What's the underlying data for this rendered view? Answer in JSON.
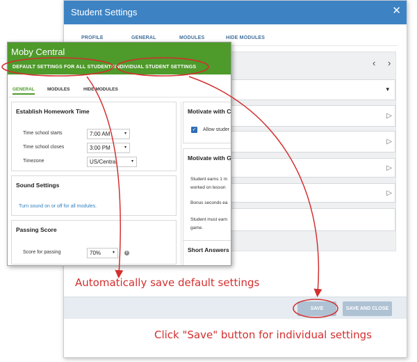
{
  "modal": {
    "title": "Student Settings",
    "close_glyph": "✕",
    "tabs": [
      "PROFILE",
      "GENERAL",
      "MODULES",
      "HIDE MODULES"
    ],
    "prev_glyph": "‹",
    "next_glyph": "›",
    "dropdown_caret": "▾",
    "field_glyph": "▷",
    "save_label": "SAVE",
    "save_close_label": "SAVE AND CLOSE"
  },
  "front": {
    "title": "Moby Central",
    "tabs": {
      "default": "DEFAULT SETTINGS FOR ALL STUDENTS",
      "individual": "INDIVIDUAL STUDENT SETTINGS"
    },
    "subtabs": [
      "GENERAL",
      "MODULES",
      "HIDE MODULES"
    ],
    "homework": {
      "title": "Establish Homework Time",
      "rows": [
        {
          "label": "Time school starts",
          "value": "7:00 AM"
        },
        {
          "label": "Time school closes",
          "value": "3:00 PM"
        },
        {
          "label": "Timezone",
          "value": "US/Central"
        }
      ]
    },
    "sound": {
      "title": "Sound Settings",
      "link": "Turn sound on or off for all modules."
    },
    "passing": {
      "title": "Passing Score",
      "label": "Score for passing",
      "value": "70%"
    },
    "motivate1": {
      "title": "Motivate with C",
      "checkbox_label": "Allow studer"
    },
    "motivate2": {
      "title": "Motivate with G",
      "lines": [
        "Student earns 1 m",
        "worked on lesson",
        "Bonus seconds ea",
        "Student must earn",
        "game."
      ]
    },
    "short_answers": {
      "title": "Short Answers"
    },
    "caret": "▾",
    "check_glyph": "✓",
    "info_glyph": "i"
  },
  "annotations": {
    "default_note": "Automatically save default settings",
    "individual_note": "Click \"Save\" button for individual settings"
  },
  "colors": {
    "blue_header": "#3d83c4",
    "green_header": "#4e9a2a",
    "annotation": "#d32f2f"
  }
}
